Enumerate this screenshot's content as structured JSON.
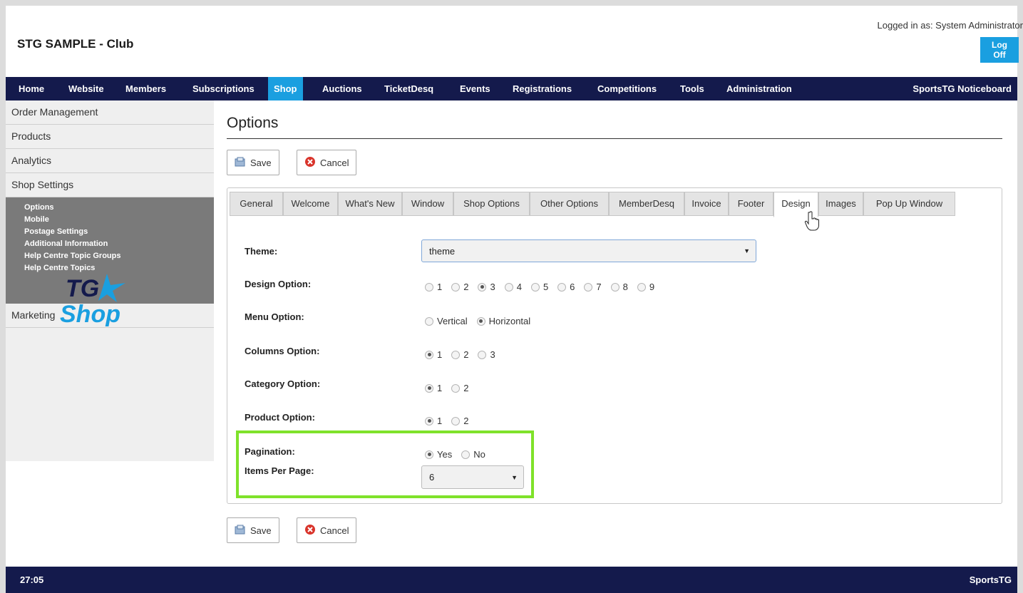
{
  "header": {
    "site_title": "STG SAMPLE - Club",
    "login_text": "Logged in as: System Administrator",
    "logoff_label": "Log Off"
  },
  "colors": {
    "nav_bg": "#141a4c",
    "accent": "#1a9fe0",
    "highlight": "#7fe22a"
  },
  "topnav": {
    "items": [
      "Home",
      "Website",
      "Members",
      "Subscriptions",
      "Shop",
      "Auctions",
      "TicketDesq",
      "Events",
      "Registrations",
      "Competitions",
      "Tools",
      "Administration"
    ],
    "active": "Shop",
    "right_label": "SportsTG Noticeboard"
  },
  "sidebar": {
    "items": [
      "Order Management",
      "Products",
      "Analytics",
      "Shop Settings",
      "Marketing"
    ],
    "subitems": [
      "Options",
      "Mobile",
      "Postage Settings",
      "Additional Information",
      "Help Centre Topic Groups",
      "Help Centre Topics"
    ],
    "logo_text_top": "TG",
    "logo_text_bottom": "Shop"
  },
  "main": {
    "title": "Options",
    "save_label": "Save",
    "cancel_label": "Cancel",
    "tabs": [
      "General",
      "Welcome",
      "What's New",
      "Window",
      "Shop Options",
      "Other Options",
      "MemberDesq",
      "Invoice",
      "Footer",
      "Design",
      "Images",
      "Pop Up Window"
    ],
    "active_tab": "Design",
    "form": {
      "theme": {
        "label": "Theme:",
        "value": "theme"
      },
      "design_option": {
        "label": "Design Option:",
        "options": [
          "1",
          "2",
          "3",
          "4",
          "5",
          "6",
          "7",
          "8",
          "9"
        ],
        "selected": "3"
      },
      "menu_option": {
        "label": "Menu Option:",
        "options": [
          "Vertical",
          "Horizontal"
        ],
        "selected": "Horizontal"
      },
      "columns_option": {
        "label": "Columns Option:",
        "options": [
          "1",
          "2",
          "3"
        ],
        "selected": "1"
      },
      "category_option": {
        "label": "Category Option:",
        "options": [
          "1",
          "2"
        ],
        "selected": "1"
      },
      "product_option": {
        "label": "Product Option:",
        "options": [
          "1",
          "2"
        ],
        "selected": "1"
      },
      "pagination": {
        "label": "Pagination:",
        "options": [
          "Yes",
          "No"
        ],
        "selected": "Yes"
      },
      "items_per_page": {
        "label": "Items Per Page:",
        "value": "6"
      }
    }
  },
  "footer": {
    "time": "27:05",
    "brand": "SportsTG"
  }
}
